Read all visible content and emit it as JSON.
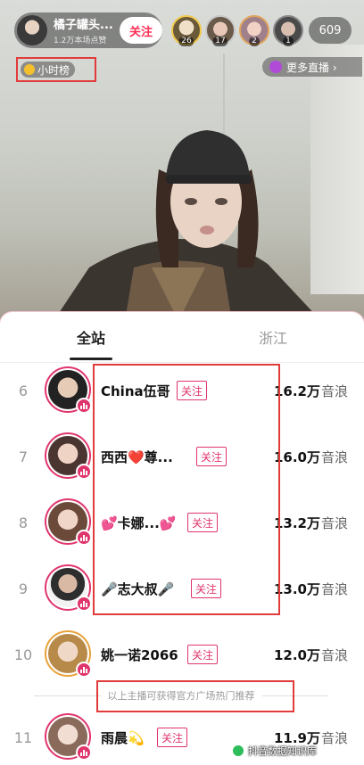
{
  "host": {
    "name": "橘子罐头...",
    "likes": "1.2万本场点赞",
    "follow_label": "关注"
  },
  "viewers": [
    {
      "badge": "26"
    },
    {
      "badge": "17"
    },
    {
      "badge": "2"
    },
    {
      "badge": "1"
    }
  ],
  "viewer_count": "609",
  "hour_rank_label": "小时榜",
  "more_live_label": "更多直播 ›",
  "tabs": [
    {
      "label": "全站",
      "active": true
    },
    {
      "label": "浙江",
      "active": false
    }
  ],
  "ranking": [
    {
      "rank": "6",
      "name": "China伍哥",
      "follow": "关注",
      "value": "16.2万",
      "unit": "音浪"
    },
    {
      "rank": "7",
      "name": "西西❤️尊...",
      "follow": "关注",
      "value": "16.0万",
      "unit": "音浪"
    },
    {
      "rank": "8",
      "name": "💕卡娜...💕",
      "follow": "关注",
      "value": "13.2万",
      "unit": "音浪"
    },
    {
      "rank": "9",
      "name": "🎤志大叔🎤",
      "follow": "关注",
      "value": "13.0万",
      "unit": "音浪"
    },
    {
      "rank": "10",
      "name": "姚一诺2066",
      "follow": "关注",
      "value": "12.0万",
      "unit": "音浪"
    },
    {
      "rank": "11",
      "name": "雨晨💫",
      "follow": "关注",
      "value": "11.9万",
      "unit": "音浪"
    }
  ],
  "recommend_note": "以上主播可获得官方广场热门推荐",
  "watermark": "抖音数据知识库",
  "colors": {
    "accent": "#e0356b",
    "highlight_box": "#e23b3b"
  }
}
